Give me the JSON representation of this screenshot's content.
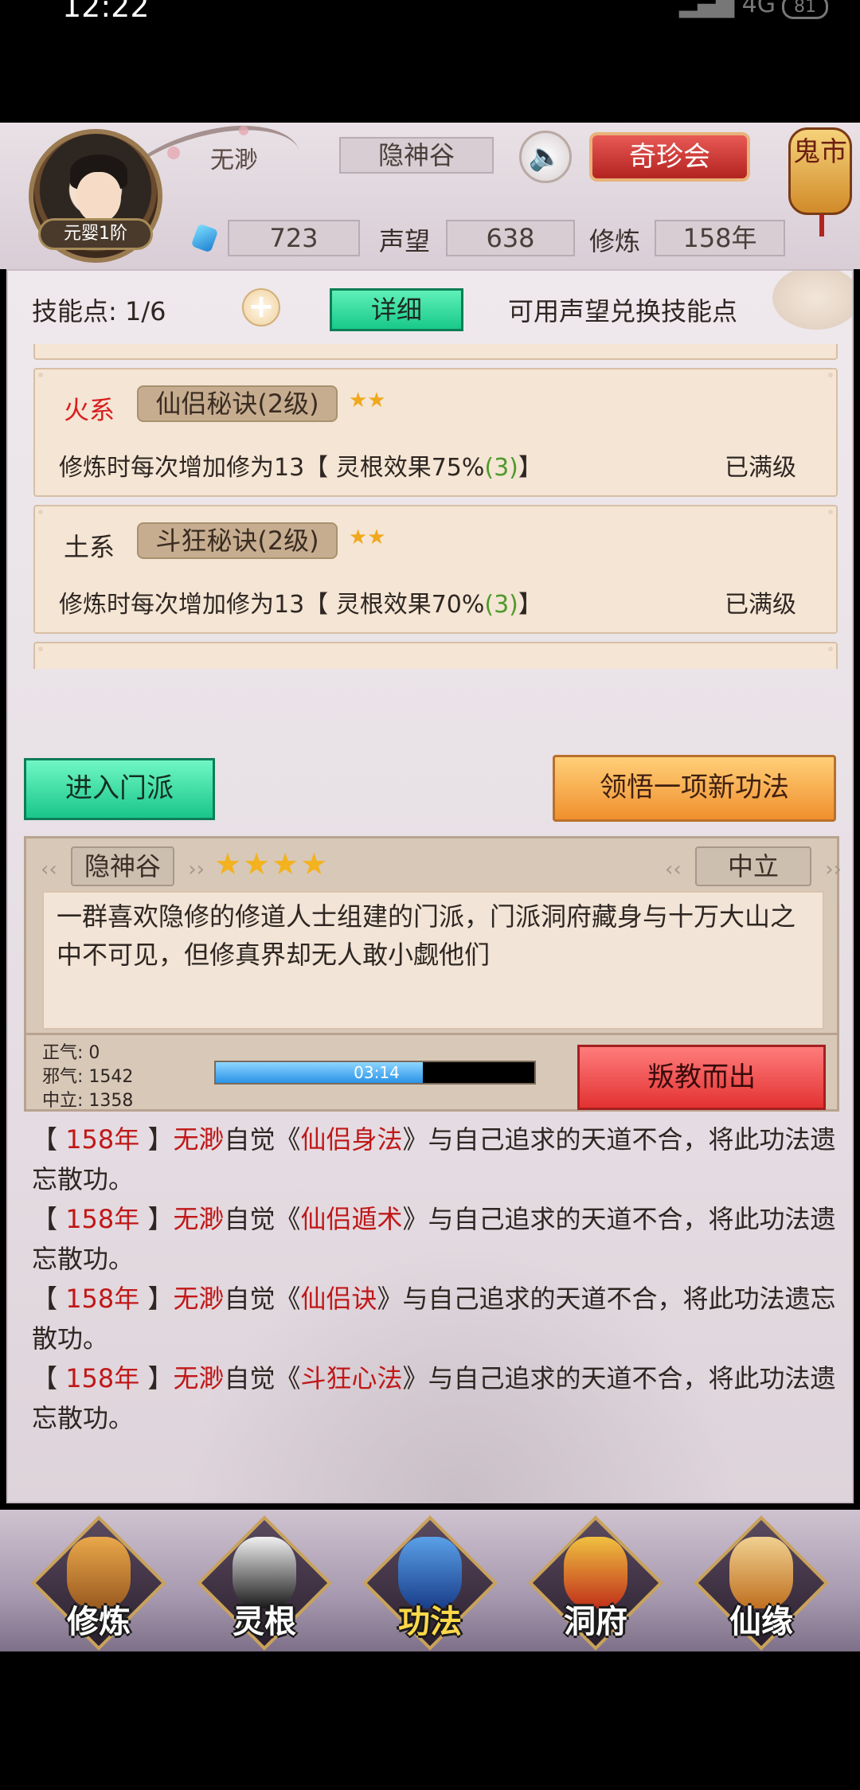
{
  "status_bar": {
    "time": "12:22",
    "signal": "4G",
    "battery": "81"
  },
  "header": {
    "rank": "元婴1阶",
    "player_name": "无渺",
    "sect": "隐神谷",
    "shop_button": "奇珍会",
    "ghost_market": "鬼市",
    "gems": "723",
    "reputation_label": "声望",
    "reputation": "638",
    "practice_label": "修炼",
    "practice": "158年"
  },
  "skills": {
    "points_label": "技能点: 1/6",
    "detail_button": "详细",
    "hint": "可用声望兑换技能点",
    "cards": [
      {
        "element": "火系",
        "element_color": "#d81e1e",
        "name": "仙侣秘诀(2级)",
        "stars": "★★",
        "desc_prefix": "修炼时每次增加修为13【 灵根效果75%",
        "desc_level": "(3)",
        "desc_suffix": "】",
        "status": "已满级"
      },
      {
        "element": "土系",
        "element_color": "#2e2622",
        "name": "斗狂秘诀(2级)",
        "stars": "★★",
        "desc_prefix": "修炼时每次增加修为13【 灵根效果70%",
        "desc_level": "(3)",
        "desc_suffix": "】",
        "status": "已满级"
      }
    ]
  },
  "actions": {
    "enter_sect": "进入门派",
    "comprehend": "领悟一项新功法"
  },
  "sect_info": {
    "name": "隐神谷",
    "stars": "★★★★",
    "alignment": "中立",
    "description": "一群喜欢隐修的修道人士组建的门派，门派洞府藏身与十万大山之中不可见，但修真界却无人敢小觑他们",
    "righteous": "正气: 0",
    "evil": "邪气: 1542",
    "neutral": "中立: 1358",
    "timer": "03:14",
    "timer_progress": 0.65,
    "betray_button": "叛教而出"
  },
  "log": [
    {
      "year": "158年",
      "name": "无渺",
      "mid": "自觉《",
      "book": "仙侣身法",
      "rest": "》与自己追求的天道不合，将此功法遗忘散功。"
    },
    {
      "year": "158年",
      "name": "无渺",
      "mid": "自觉《",
      "book": "仙侣遁术",
      "rest": "》与自己追求的天道不合，将此功法遗忘散功。"
    },
    {
      "year": "158年",
      "name": "无渺",
      "mid": "自觉《",
      "book": "仙侣诀",
      "rest": "》与自己追求的天道不合，将此功法遗忘散功。"
    },
    {
      "year": "158年",
      "name": "无渺",
      "mid": "自觉《",
      "book": "斗狂心法",
      "rest": "》与自己追求的天道不合，将此功法遗忘散功。"
    }
  ],
  "nav": [
    {
      "label": "修炼",
      "icon": "hooded-cultivator-icon"
    },
    {
      "label": "灵根",
      "icon": "yin-yang-sword-icon"
    },
    {
      "label": "功法",
      "icon": "book-icon",
      "active": true
    },
    {
      "label": "洞府",
      "icon": "palace-icon"
    },
    {
      "label": "仙缘",
      "icon": "gourd-icon"
    }
  ],
  "colors": {
    "accent_green": "#19c68b",
    "accent_orange": "#f0902e",
    "accent_red": "#e33232",
    "log_highlight": "#c01818"
  }
}
